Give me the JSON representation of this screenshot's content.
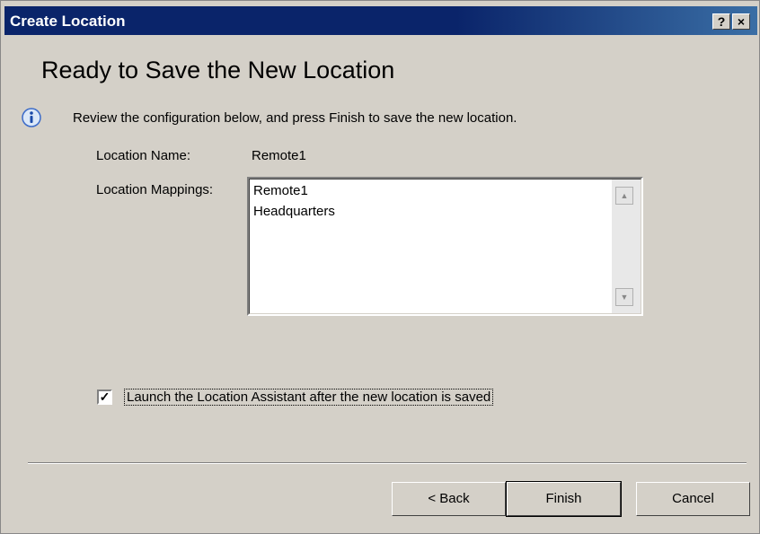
{
  "window": {
    "title": "Create Location",
    "help_label": "?",
    "close_label": "×"
  },
  "page": {
    "heading": "Ready to Save the New Location",
    "intro": "Review the configuration below, and press Finish to save the new location."
  },
  "fields": {
    "location_name_label": "Location Name:",
    "location_name_value": "Remote1",
    "location_mappings_label": "Location Mappings:",
    "location_mappings": [
      "Remote1",
      "Headquarters"
    ]
  },
  "checkbox": {
    "label": "Launch the Location Assistant after the new location is saved",
    "checked": true
  },
  "buttons": {
    "back": "< Back",
    "finish": "Finish",
    "cancel": "Cancel"
  },
  "icons": {
    "info": "info-icon",
    "scroll_up": "scroll-up-arrow-icon",
    "scroll_down": "scroll-down-arrow-icon"
  },
  "colors": {
    "titlebar": "#0a246a",
    "dialog_bg": "#d4d0c8"
  }
}
